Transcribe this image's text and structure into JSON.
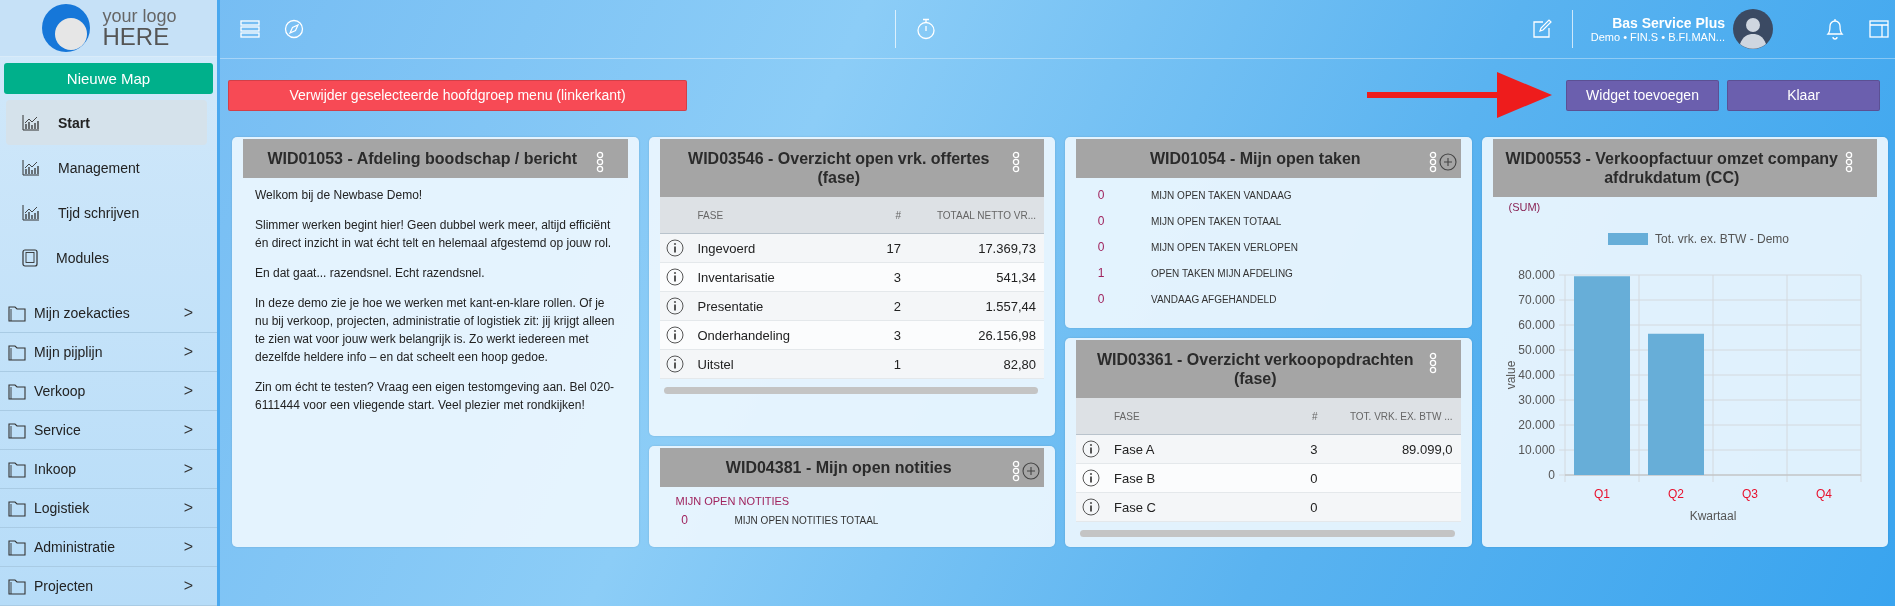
{
  "logo": {
    "line_1": "your logo",
    "line_2": "HERE"
  },
  "new_map_button": "Nieuwe Map",
  "nav": [
    {
      "label": "Start",
      "kind": "chart",
      "selected": true
    },
    {
      "label": "Management",
      "kind": "chart",
      "selected": false
    },
    {
      "label": "Tijd schrijven",
      "kind": "chart",
      "selected": false
    },
    {
      "label": "Modules",
      "kind": "tablet",
      "selected": false
    }
  ],
  "folders": [
    {
      "label": "Mijn zoekacties",
      "chevron": ">"
    },
    {
      "label": "Mijn pijplijn",
      "chevron": ">"
    },
    {
      "label": "Verkoop",
      "chevron": ">"
    },
    {
      "label": "Service",
      "chevron": ">"
    },
    {
      "label": "Inkoop",
      "chevron": ">"
    },
    {
      "label": "Logistiek",
      "chevron": ">"
    },
    {
      "label": "Administratie",
      "chevron": ">"
    },
    {
      "label": "Projecten",
      "chevron": ">"
    }
  ],
  "topbar": {
    "user_name": "Bas Service Plus",
    "user_detail": "Demo • FIN.S • B.FI.MAN..."
  },
  "actions": {
    "delete_button": "Verwijder geselecteerde hoofdgroep menu (linkerkant)",
    "add_widget_button": "Widget toevoegen",
    "done_button": "Klaar"
  },
  "columns": [
    [
      {
        "kind": "text",
        "title": "WID01053 - Afdeling boodschap / bericht",
        "add_button": false,
        "paragraphs": [
          "Welkom bij de Newbase Demo!",
          "Slimmer werken begint hier! Geen dubbel werk meer, altijd efficiënt én direct inzicht in wat écht telt en helemaal afgestemd op jouw rol.",
          "En dat gaat... razendsnel. Echt razendsnel.",
          "In deze demo zie je hoe we werken met kant-en-klare rollen. Of je nu bij verkoop, projecten, administratie of logistiek zit: jij krijgt alleen te zien wat voor jouw werk belangrijk is. Zo werkt iedereen met dezelfde heldere info – en dat scheelt een hoop gedoe.",
          "Zin om écht te testen? Vraag een eigen testomgeving aan. Bel 020-6111444 voor een vliegende start. Veel plezier met rondkijken!"
        ]
      }
    ],
    [
      {
        "kind": "table",
        "title": "WID03546 - Overzicht open vrk. offertes (fase)",
        "add_button": false,
        "columns": [
          "FASE",
          "#",
          "TOTAAL NETTO VR..."
        ],
        "rows": [
          {
            "fase": "Ingevoerd",
            "count": "17",
            "total": "17.369,73"
          },
          {
            "fase": "Inventarisatie",
            "count": "3",
            "total": "541,34"
          },
          {
            "fase": "Presentatie",
            "count": "2",
            "total": "1.557,44"
          },
          {
            "fase": "Onderhandeling",
            "count": "3",
            "total": "26.156,98"
          },
          {
            "fase": "Uitstel",
            "count": "1",
            "total": "82,80"
          }
        ]
      },
      {
        "kind": "counters",
        "title": "WID04381 - Mijn open notities",
        "subtitle": "MIJN OPEN NOTITIES",
        "add_button": true,
        "rows": [
          {
            "value": "0",
            "label": "MIJN OPEN NOTITIES TOTAAL"
          }
        ]
      }
    ],
    [
      {
        "kind": "counters",
        "title": "WID01054 - Mijn open taken",
        "add_button": true,
        "rows": [
          {
            "value": "0",
            "label": "MIJN OPEN TAKEN VANDAAG"
          },
          {
            "value": "0",
            "label": "MIJN OPEN TAKEN TOTAAL"
          },
          {
            "value": "0",
            "label": "MIJN OPEN TAKEN VERLOPEN"
          },
          {
            "value": "1",
            "label": "OPEN TAKEN MIJN AFDELING"
          },
          {
            "value": "0",
            "label": "VANDAAG AFGEHANDELD"
          }
        ]
      },
      {
        "kind": "table",
        "title": "WID03361 - Overzicht verkoopopdrachten (fase)",
        "add_button": false,
        "columns": [
          "FASE",
          "#",
          "TOT. VRK. EX. BTW ..."
        ],
        "rows": [
          {
            "fase": "Fase A",
            "count": "3",
            "total": "89.099,0"
          },
          {
            "fase": "Fase B",
            "count": "0"
          },
          {
            "fase": "Fase C",
            "count": "0"
          }
        ]
      }
    ],
    [
      {
        "kind": "chart",
        "title": "WID00553 - Verkoopfactuur omzet company afdrukdatum (CC)",
        "subtitle": "(SUM)",
        "add_button": false,
        "chart_data": {
          "type": "bar",
          "xlabel": "Kwartaal",
          "ylabel": "value",
          "categories": [
            "Q1",
            "Q2",
            "Q3",
            "Q4"
          ],
          "series": [
            {
              "name": "Tot. vrk. ex. BTW - Demo",
              "color": "#67aed8",
              "values": [
                79500,
                56500,
                0,
                0
              ]
            }
          ],
          "ylim": [
            0,
            80000
          ],
          "grid": true,
          "yticks": [
            {
              "value": 0,
              "label": "0"
            },
            {
              "value": 10000,
              "label": "10.000"
            },
            {
              "value": 20000,
              "label": "20.000"
            },
            {
              "value": 30000,
              "label": "30.000"
            },
            {
              "value": 40000,
              "label": "40.000"
            },
            {
              "value": 50000,
              "label": "50.000"
            },
            {
              "value": 60000,
              "label": "60.000"
            },
            {
              "value": 70000,
              "label": "70.000"
            },
            {
              "value": 80000,
              "label": "80.000"
            }
          ]
        }
      }
    ]
  ]
}
